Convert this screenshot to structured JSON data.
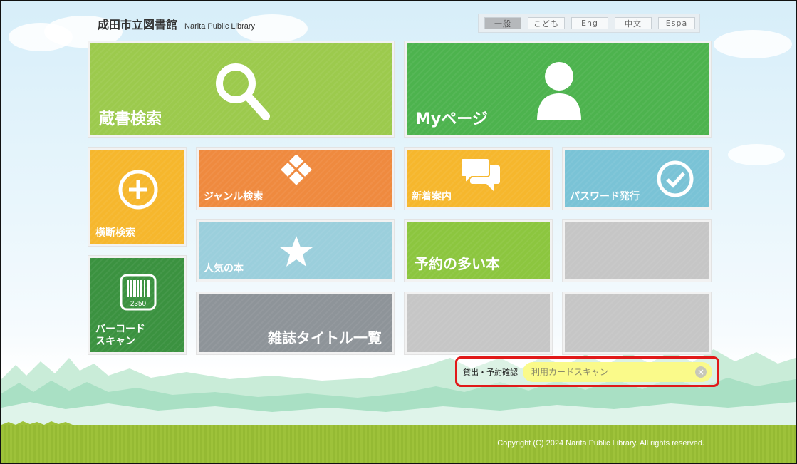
{
  "header": {
    "title_jp": "成田市立図書館",
    "title_en": "Narita Public Library"
  },
  "languages": [
    {
      "label": "一般",
      "active": true
    },
    {
      "label": "こども",
      "active": false
    },
    {
      "label": "Eng",
      "active": false
    },
    {
      "label": "中文",
      "active": false
    },
    {
      "label": "Espa",
      "active": false
    }
  ],
  "tiles": {
    "search": {
      "label": "蔵書検索",
      "icon": "search-icon"
    },
    "mypage": {
      "label": "Myページ",
      "icon": "user-icon"
    },
    "cross_search": {
      "label": "横断検索",
      "icon": "plus-circle-icon"
    },
    "genre": {
      "label": "ジャンル検索",
      "icon": "diamond-grid-icon"
    },
    "new_arrivals": {
      "label": "新着案内",
      "icon": "chat-bubbles-icon"
    },
    "password": {
      "label": "パスワード発行",
      "icon": "check-circle-icon"
    },
    "popular": {
      "label": "人気の本",
      "icon": "star-icon"
    },
    "most_reserved": {
      "label": "予約の多い本"
    },
    "barcode": {
      "label_line1": "バーコード",
      "label_line2": "スキャン",
      "icon": "barcode-icon",
      "icon_number": "2350"
    },
    "magazine": {
      "label": "雑誌タイトル一覧"
    }
  },
  "lending": {
    "label": "貸出・予約確認",
    "placeholder": "利用カードスキャン",
    "clear_symbol": "×"
  },
  "footer": {
    "copyright": "Copyright (C) 2024 Narita Public Library. All rights reserved."
  },
  "colors": {
    "lime": "#9cca4d",
    "green": "#4db34e",
    "yellow": "#f6b72d",
    "orange": "#ef8a3f",
    "sky": "#7ac3d6",
    "dark_green": "#3b9240",
    "gray": "#8e9499",
    "highlight_red": "#e11919"
  }
}
